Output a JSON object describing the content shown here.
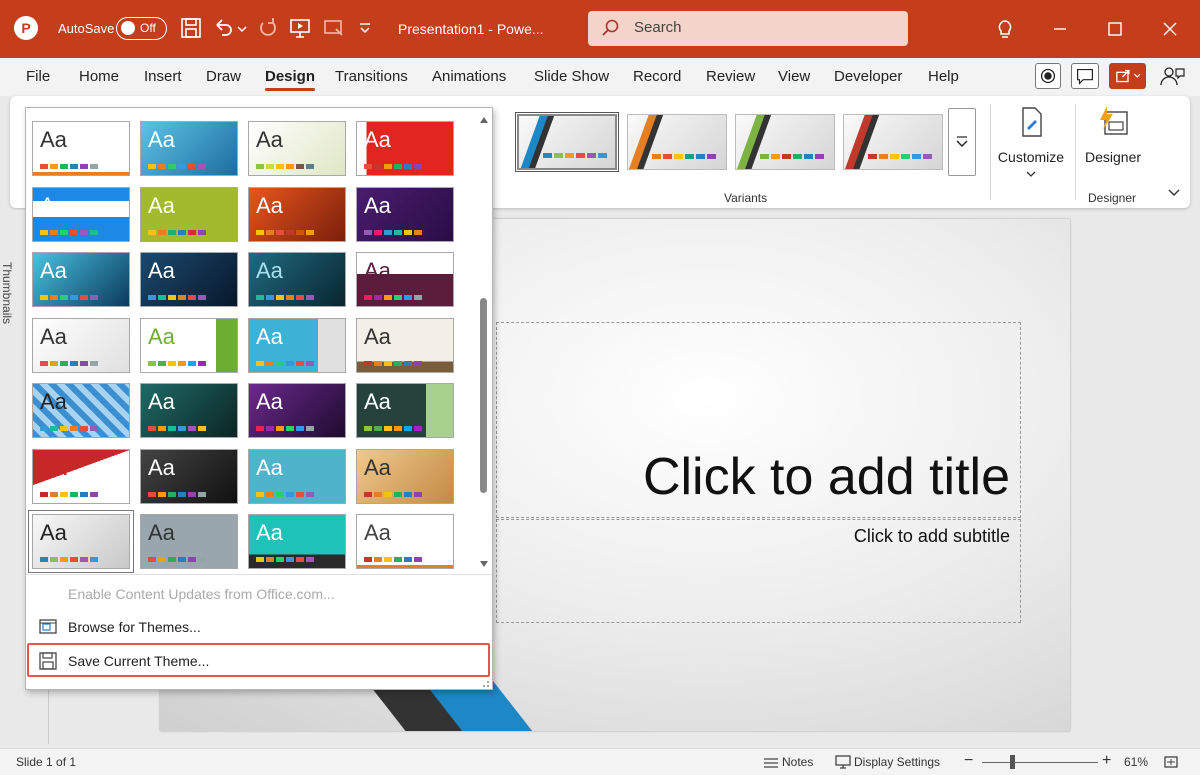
{
  "app": {
    "logo_letter": "P",
    "autosave_label": "AutoSave",
    "autosave_state": "Off",
    "document_title": "Presentation1 - Powe...",
    "search_placeholder": "Search",
    "accent": "#c43e1c"
  },
  "menu_tabs": [
    "File",
    "Home",
    "Insert",
    "Draw",
    "Design",
    "Transitions",
    "Animations",
    "Slide Show",
    "Record",
    "Review",
    "View",
    "Developer",
    "Help"
  ],
  "active_tab": "Design",
  "ribbon": {
    "variants_label": "Variants",
    "customize_label": "Customize",
    "designer_label": "Designer",
    "designer_group_label": "Designer",
    "variants": [
      {
        "stripe": "#1e88c7",
        "dots": [
          "#1e88c7",
          "#8bc34a",
          "#f39c12",
          "#e74c3c",
          "#9b59b6",
          "#3498db"
        ]
      },
      {
        "stripe": "#e67e22",
        "dots": [
          "#e67e22",
          "#e74c3c",
          "#f1c40f",
          "#16a085",
          "#2980b9",
          "#8e44ad"
        ]
      },
      {
        "stripe": "#7cb342",
        "dots": [
          "#7cb342",
          "#f39c12",
          "#c0392b",
          "#27ae60",
          "#2980b9",
          "#8e44ad"
        ]
      },
      {
        "stripe": "#c0392b",
        "dots": [
          "#c0392b",
          "#e67e22",
          "#f1c40f",
          "#2ecc71",
          "#3498db",
          "#9b59b6"
        ]
      }
    ]
  },
  "gallery": {
    "themes": [
      {
        "bg": "#ffffff",
        "fg": "#333333",
        "text": "Aa",
        "dots": [
          "#e74c3c",
          "#f39c12",
          "#27ae60",
          "#2980b9",
          "#8e44ad",
          "#95a5a6"
        ],
        "bottom_bar": "#e67e22"
      },
      {
        "bg": "linear-gradient(135deg,#5ec2e8,#1c6e9c)",
        "fg": "#ffffff",
        "text": "Aa",
        "dots": [
          "#f1c40f",
          "#e67e22",
          "#2ecc71",
          "#3498db",
          "#e74c3c",
          "#9b59b6"
        ]
      },
      {
        "bg": "linear-gradient(135deg,#ffffff,#dfe6c4)",
        "fg": "#333333",
        "text": "Aa",
        "dots": [
          "#8bc34a",
          "#cddc39",
          "#ffc107",
          "#ff9800",
          "#795548",
          "#607d8b"
        ]
      },
      {
        "bg": "linear-gradient(90deg,#ffffff 0%,#ffffff 10%,#e3251f 10%)",
        "fg": "#ffffff",
        "text": "Aa",
        "dots": [
          "#e74c3c",
          "#c0392b",
          "#f39c12",
          "#27ae60",
          "#2980b9",
          "#8e44ad"
        ]
      },
      {
        "bg": "linear-gradient(180deg,#1e88e5 0%,#1e88e5 25%,#ffffff 25%,#ffffff 55%,#1e88e5 55%)",
        "fg": "#ffffff",
        "text": "Aa",
        "dots": [
          "#f1c40f",
          "#e67e22",
          "#2ecc71",
          "#e74c3c",
          "#9b59b6",
          "#1abc9c"
        ]
      },
      {
        "bg": "#a3b92e",
        "fg": "#ffffff",
        "text": "Aa",
        "dots": [
          "#f1c40f",
          "#e67e22",
          "#27ae60",
          "#2980b9",
          "#c0392b",
          "#8e44ad"
        ]
      },
      {
        "bg": "linear-gradient(135deg,#e8561d,#7a1f0b)",
        "fg": "#ffffff",
        "text": "Aa",
        "dots": [
          "#f1c40f",
          "#e67e22",
          "#e74c3c",
          "#c0392b",
          "#d35400",
          "#f39c12"
        ]
      },
      {
        "bg": "linear-gradient(135deg,#4a1d6e,#2a0d44)",
        "fg": "#ffffff",
        "text": "Aa",
        "dots": [
          "#9b59b6",
          "#e91e63",
          "#3498db",
          "#1abc9c",
          "#f1c40f",
          "#e67e22"
        ]
      },
      {
        "bg": "linear-gradient(135deg,#4ac1e0,#0b3a5c)",
        "fg": "#ffffff",
        "text": "Aa",
        "dots": [
          "#f1c40f",
          "#e67e22",
          "#2ecc71",
          "#3498db",
          "#e74c3c",
          "#9b59b6"
        ]
      },
      {
        "bg": "linear-gradient(135deg,#1b4a6e,#07182b)",
        "fg": "#ffffff",
        "text": "Aa",
        "dots": [
          "#3498db",
          "#1abc9c",
          "#f1c40f",
          "#e67e22",
          "#e74c3c",
          "#9b59b6"
        ]
      },
      {
        "bg": "linear-gradient(135deg,#1f6b80,#0a2530)",
        "fg": "#a7e0ee",
        "text": "Aa",
        "dots": [
          "#1abc9c",
          "#3498db",
          "#f1c40f",
          "#e67e22",
          "#e74c3c",
          "#9b59b6"
        ]
      },
      {
        "bg": "linear-gradient(180deg,#ffffff 0%,#ffffff 40%,#5c1c3c 40%)",
        "fg": "#5c1c3c",
        "text": "Aa",
        "dots": [
          "#e91e63",
          "#9c27b0",
          "#f39c12",
          "#2ecc71",
          "#3498db",
          "#95a5a6"
        ]
      },
      {
        "bg": "linear-gradient(135deg,#ffffff,#e0e0e0)",
        "fg": "#333333",
        "text": "Aa",
        "dots": [
          "#e74c3c",
          "#f39c12",
          "#27ae60",
          "#2980b9",
          "#8e44ad",
          "#95a5a6"
        ]
      },
      {
        "bg": "linear-gradient(90deg,#ffffff 0%,#ffffff 78%,#6cae32 78%)",
        "fg": "#6cae32",
        "text": "Aa",
        "dots": [
          "#8bc34a",
          "#4caf50",
          "#ffc107",
          "#ff9800",
          "#03a9f4",
          "#9c27b0"
        ]
      },
      {
        "bg": "linear-gradient(90deg,#3cb2d6 0%,#3cb2d6 72%,#e0e0e0 72%)",
        "fg": "#ffffff",
        "text": "Aa",
        "dots": [
          "#f1c40f",
          "#e67e22",
          "#2ecc71",
          "#3498db",
          "#e74c3c",
          "#9b59b6"
        ]
      },
      {
        "bg": "linear-gradient(180deg,#f3efe6 0%,#f3efe6 80%,#7a5b3a 80%)",
        "fg": "#333333",
        "text": "Aa",
        "dots": [
          "#c0392b",
          "#e67e22",
          "#f1c40f",
          "#27ae60",
          "#2980b9",
          "#8e44ad"
        ]
      },
      {
        "bg": "repeating-linear-gradient(45deg,#3b8fd0 0 6px,#a7d3f0 6px 12px)",
        "fg": "#222222",
        "text": "Aa",
        "dots": [
          "#3498db",
          "#1abc9c",
          "#f1c40f",
          "#e67e22",
          "#e74c3c",
          "#9b59b6"
        ]
      },
      {
        "bg": "linear-gradient(135deg,#1f6a66,#0b2524)",
        "fg": "#ffffff",
        "text": "Aa",
        "dots": [
          "#e74c3c",
          "#f39c12",
          "#1abc9c",
          "#3498db",
          "#9b59b6",
          "#f1c40f"
        ]
      },
      {
        "bg": "linear-gradient(135deg,#6b2a8c,#1e0b2e)",
        "fg": "#ffffff",
        "text": "Aa",
        "dots": [
          "#e91e63",
          "#9c27b0",
          "#f39c12",
          "#2ecc71",
          "#3498db",
          "#95a5a6"
        ]
      },
      {
        "bg": "linear-gradient(90deg,#25433c 0%,#25433c 72%,#a8d08d 72%)",
        "fg": "#ffffff",
        "text": "Aa",
        "dots": [
          "#8bc34a",
          "#4caf50",
          "#ffc107",
          "#ff9800",
          "#03a9f4",
          "#9c27b0"
        ]
      },
      {
        "bg": "linear-gradient(160deg,#c62828 0%,#c62828 40%,#ffffff 40%)",
        "fg": "#c62828",
        "text": "Aa",
        "dots": [
          "#c62828",
          "#e67e22",
          "#f1c40f",
          "#27ae60",
          "#2980b9",
          "#8e44ad"
        ]
      },
      {
        "bg": "linear-gradient(135deg,#444444,#111111)",
        "fg": "#ffffff",
        "text": "Aa",
        "dots": [
          "#e74c3c",
          "#f39c12",
          "#27ae60",
          "#2980b9",
          "#8e44ad",
          "#95a5a6"
        ]
      },
      {
        "bg": "#4fb3cc",
        "fg": "#ffffff",
        "text": "Aa",
        "dots": [
          "#f1c40f",
          "#e67e22",
          "#2ecc71",
          "#3498db",
          "#e74c3c",
          "#9b59b6"
        ]
      },
      {
        "bg": "linear-gradient(135deg,#f0c98d,#c28a45)",
        "fg": "#333333",
        "text": "Aa",
        "dots": [
          "#c0392b",
          "#e67e22",
          "#f1c40f",
          "#27ae60",
          "#2980b9",
          "#8e44ad"
        ]
      },
      {
        "bg": "linear-gradient(135deg,#f8f8f8,#c8c8c8)",
        "fg": "#222222",
        "text": "Aa",
        "dots": [
          "#1e88c7",
          "#8bc34a",
          "#f39c12",
          "#e74c3c",
          "#9b59b6",
          "#3498db"
        ],
        "selected": true
      },
      {
        "bg": "#9aa6ad",
        "fg": "#333333",
        "text": "Aa",
        "dots": [
          "#e74c3c",
          "#f39c12",
          "#27ae60",
          "#2980b9",
          "#8e44ad",
          "#95a5a6"
        ]
      },
      {
        "bg": "linear-gradient(180deg,#1ec2b8 0%,#1ec2b8 75%,#2a2a2a 75%)",
        "fg": "#ffffff",
        "text": "Aa",
        "dots": [
          "#f1c40f",
          "#e67e22",
          "#2ecc71",
          "#3498db",
          "#e74c3c",
          "#9b59b6"
        ]
      },
      {
        "bg": "#ffffff",
        "fg": "#444444",
        "text": "Aa",
        "dots": [
          "#c0392b",
          "#e67e22",
          "#f1c40f",
          "#27ae60",
          "#2980b9",
          "#8e44ad"
        ],
        "bottom_bar": "#e67e22"
      }
    ],
    "menu": {
      "enable_updates": "Enable Content Updates from Office.com...",
      "browse_themes": "Browse for Themes...",
      "save_theme": "Save Current Theme..."
    }
  },
  "thumbnails_label": "Thumbnails",
  "slide": {
    "title_placeholder": "Click to add title",
    "subtitle_placeholder": "Click to add subtitle"
  },
  "status": {
    "slide_counter": "Slide 1 of 1",
    "notes": "Notes",
    "display_settings": "Display Settings",
    "zoom_minus": "−",
    "zoom_plus": "+",
    "zoom_level": "61%"
  }
}
